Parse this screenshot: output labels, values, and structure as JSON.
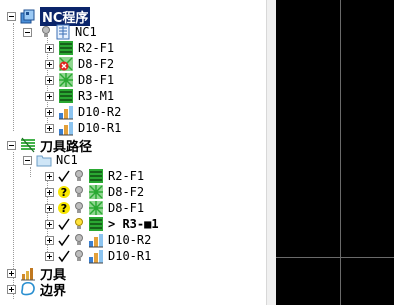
{
  "tree": {
    "nc_root": {
      "label": "NC程序",
      "icon": "nc-program-icon"
    },
    "nc_child": {
      "label": "NC1",
      "icon": "nc-file-icon"
    },
    "nc_items": [
      {
        "label": "R2-F1",
        "icon": "toolpath-raster-icon"
      },
      {
        "label": "D8-F2",
        "icon": "toolpath-error-icon"
      },
      {
        "label": "D8-F1",
        "icon": "toolpath-cross-icon"
      },
      {
        "label": "R3-M1",
        "icon": "toolpath-raster-icon"
      },
      {
        "label": "D10-R2",
        "icon": "toolpath-roughing-icon"
      },
      {
        "label": "D10-R1",
        "icon": "toolpath-roughing-icon"
      }
    ],
    "toolpath_root": {
      "label": "刀具路径",
      "icon": "toolpath-folder-icon"
    },
    "toolpath_child": {
      "label": "NC1",
      "icon": "folder-icon"
    },
    "toolpath_items": [
      {
        "label": "R2-F1",
        "status": "check",
        "icon": "toolpath-raster-icon"
      },
      {
        "label": "D8-F2",
        "status": "question",
        "icon": "toolpath-cross-icon"
      },
      {
        "label": "D8-F1",
        "status": "question",
        "icon": "toolpath-cross-icon"
      },
      {
        "label": "> R3-■1",
        "status": "check",
        "icon": "toolpath-raster-icon",
        "active": true
      },
      {
        "label": "D10-R2",
        "status": "check",
        "icon": "toolpath-roughing-icon"
      },
      {
        "label": "D10-R1",
        "status": "check",
        "icon": "toolpath-roughing-icon"
      }
    ],
    "tools_root": {
      "label": "刀具",
      "icon": "tool-icon"
    },
    "boundary_root": {
      "label": "边界",
      "icon": "boundary-icon"
    }
  },
  "colors": {
    "selection": "#0a246a",
    "viewport_bg": "#000000",
    "raster_green": "#2aa832"
  }
}
